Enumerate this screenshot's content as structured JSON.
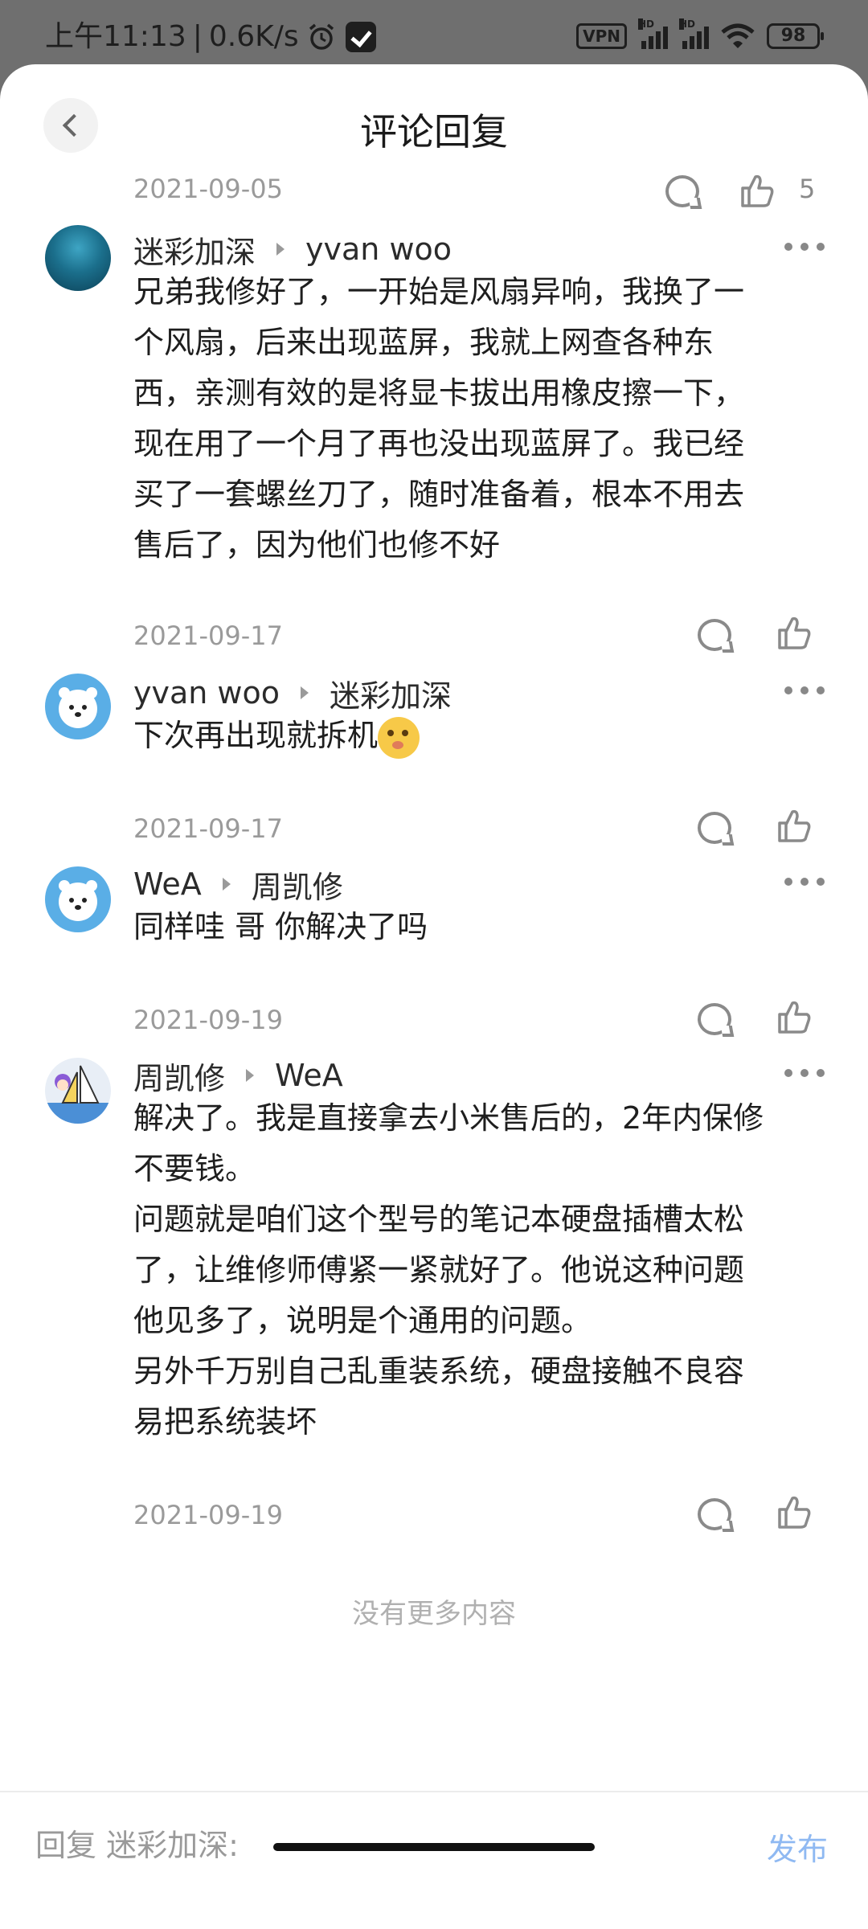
{
  "status_bar": {
    "time": "上午11:13",
    "speed": "0.6K/s",
    "vpn": "VPN",
    "hd1": "HD",
    "hd2": "HD",
    "battery": "98"
  },
  "header": {
    "title": "评论回复"
  },
  "top_meta": {
    "date": "2021-09-05",
    "like_count": "5"
  },
  "comments": [
    {
      "author": "迷彩加深",
      "reply_to": "yvan woo",
      "text": "兄弟我修好了，一开始是风扇异响，我换了一\n个风扇，后来出现蓝屏，我就上网查各种东\n西，亲测有效的是将显卡拔出用橡皮擦一下，\n现在用了一个月了再也没出现蓝屏了。我已经\n买了一套螺丝刀了，随时准备着，根本不用去\n售后了，因为他们也修不好",
      "date": "2021-09-17"
    },
    {
      "author": "yvan woo",
      "reply_to": "迷彩加深",
      "text": "下次再出现就拆机",
      "date": "2021-09-17"
    },
    {
      "author": "WeA",
      "reply_to": "周凯修",
      "text": "同样哇 哥 你解决了吗",
      "date": "2021-09-19"
    },
    {
      "author": "周凯修",
      "reply_to": "WeA",
      "text": "解决了。我是直接拿去小米售后的，2年内保修\n不要钱。\n问题就是咱们这个型号的笔记本硬盘插槽太松\n了，让维修师傅紧一紧就好了。他说这种问题\n他见多了，说明是个通用的问题。\n另外千万别自己乱重装系统，硬盘接触不良容\n易把系统装坏",
      "date": "2021-09-19"
    }
  ],
  "footer": {
    "no_more": "没有更多内容",
    "reply_placeholder": "回复 迷彩加深:",
    "publish_label": "发布"
  },
  "colors": {
    "accent_disabled": "#8fb9f2",
    "meta_gray": "#9a9a9a"
  },
  "icons": [
    "back-arrow-icon",
    "comment-icon",
    "like-icon",
    "more-icon",
    "alarm-icon",
    "wifi-icon",
    "battery-icon"
  ]
}
